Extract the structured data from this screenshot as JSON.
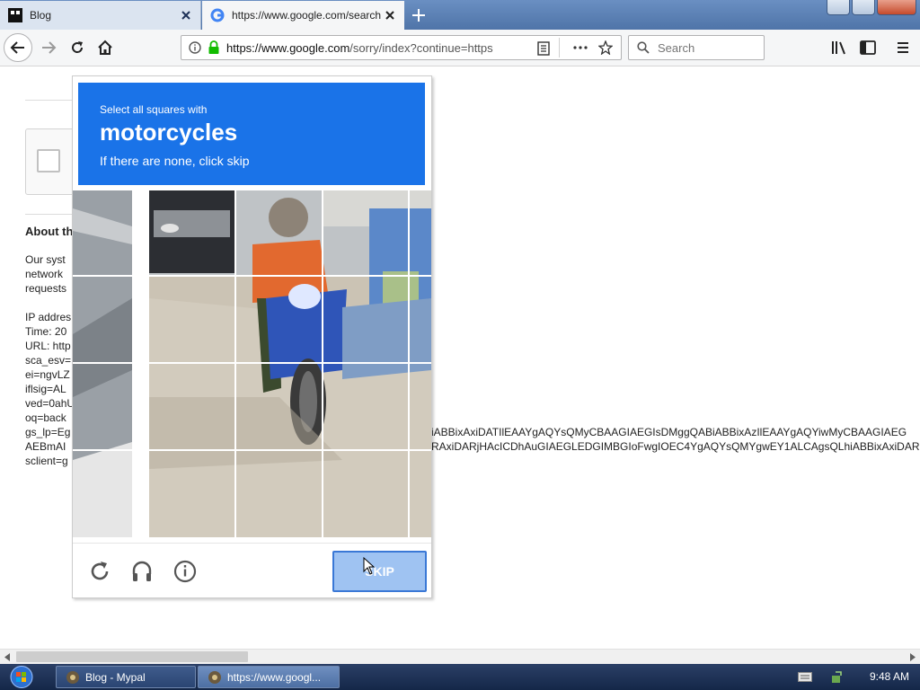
{
  "browser": {
    "tabs": [
      {
        "label": "Blog",
        "favicon": "blog-favicon"
      },
      {
        "label": "https://www.google.com/search",
        "favicon": "google-favicon"
      }
    ],
    "url": {
      "host": "https://www.google.com",
      "path": "/sorry/index?continue=https"
    },
    "search_placeholder": "Search"
  },
  "page": {
    "about_title": "About th",
    "left_lines": [
      "Our syst",
      "network",
      "requests",
      "IP addres",
      "Time: 20",
      "URL: http",
      "sca_esv=",
      "ei=ngvLZ",
      "iflsig=AL",
      "ved=0ahU",
      "oq=back",
      "gs_lp=Eg",
      "AEBmAI",
      "sclient=g"
    ],
    "right_lines": [
      "iABBixAxiDATIlEAAYgAQYsQMyCBAAGIAEGIsDMggQABiABBixAzIlEAAYgAQYiwMyCBAAGIAEG",
      "RAxiDARjHAcICDhAuGIAEGLEDGIMBGIoFwgIOEC4YgAQYsQMYgwEY1ALCAgsQLhiABBixAxiDAR"
    ]
  },
  "captcha": {
    "instruction": "Select all squares with",
    "target": "motorcycles",
    "subtext": "If there are none, click skip",
    "skip_label": "SKIP",
    "footer_icons": [
      "reload-icon",
      "audio-icon",
      "info-icon"
    ],
    "header_color": "#1a73e8"
  },
  "taskbar": {
    "items": [
      {
        "label": "Blog - Mypal"
      },
      {
        "label": "https://www.googl..."
      }
    ],
    "clock": "9:48 AM"
  }
}
